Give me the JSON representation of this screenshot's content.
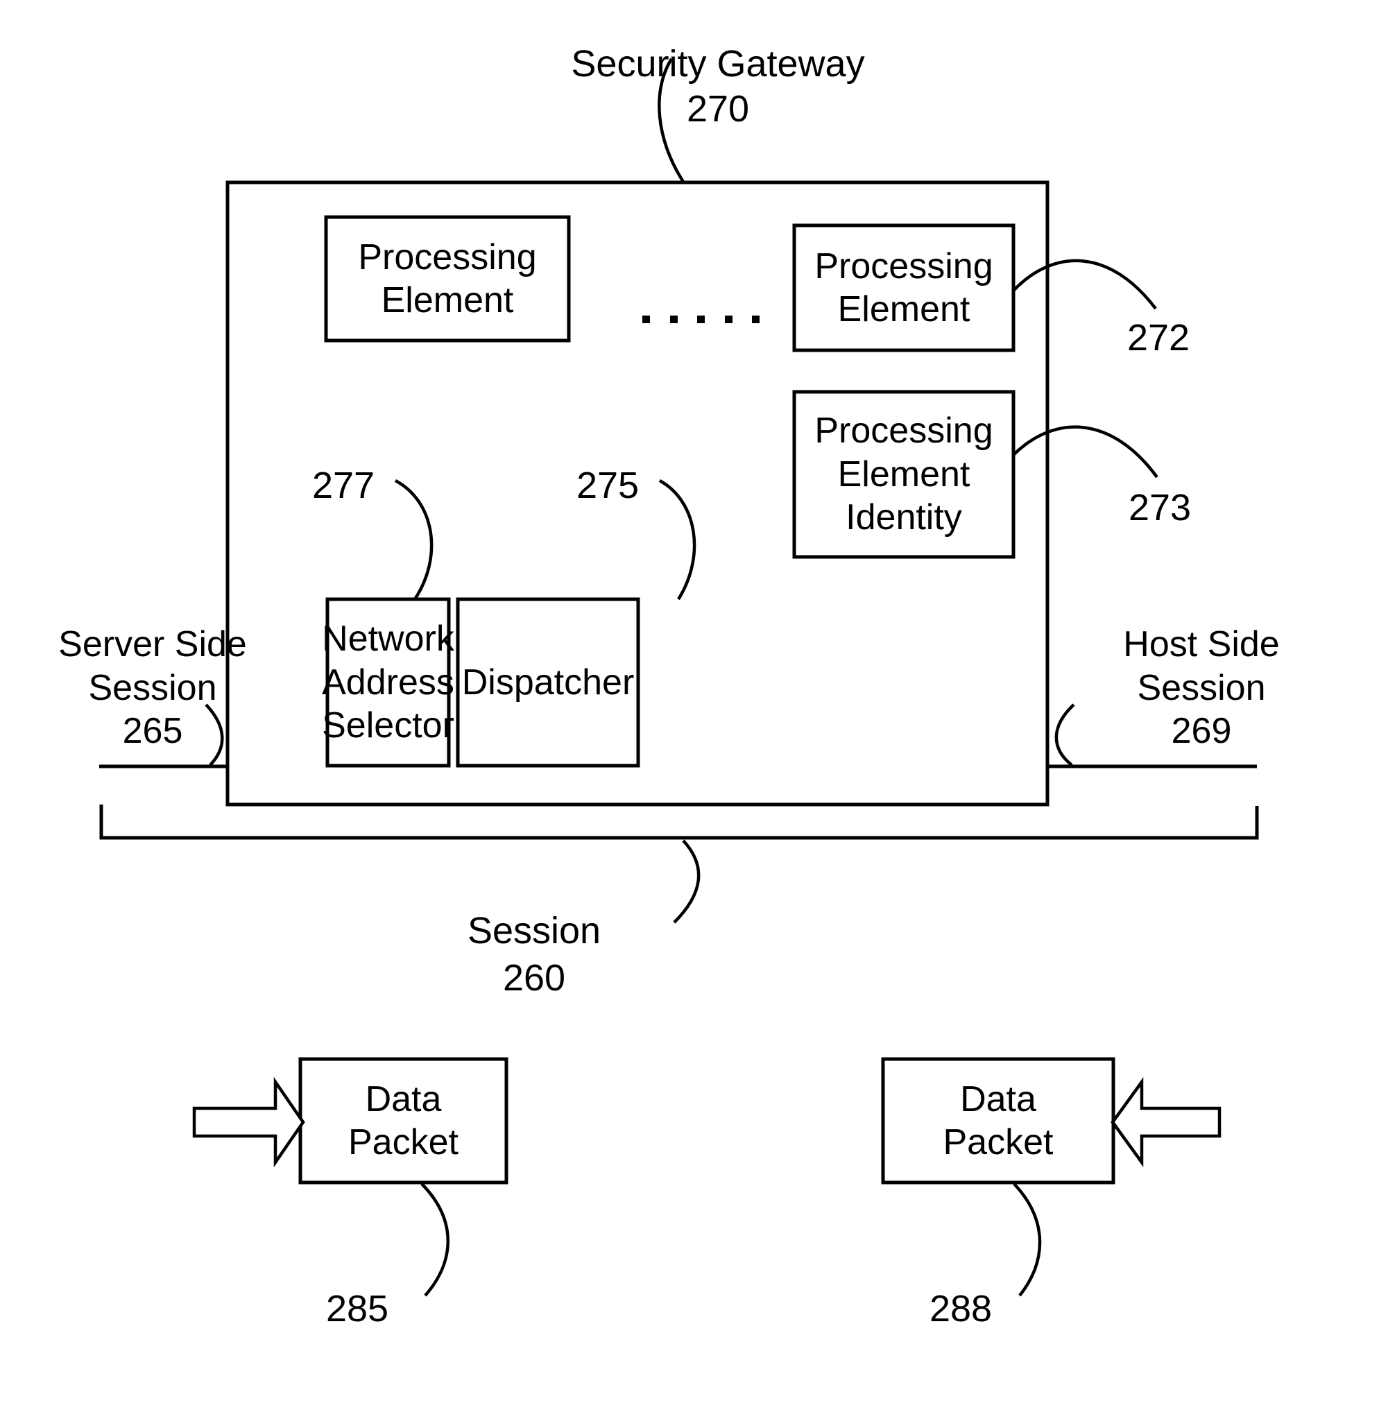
{
  "figure": {
    "title_callout": {
      "label": "Security Gateway",
      "ref": "270"
    },
    "gateway": {
      "processing_element_left": "Processing\nElement",
      "ellipsis": ". . . . .",
      "processing_element_right": "Processing\nElement",
      "processing_element_right_ref": "272",
      "processing_element_identity": "Processing\nElement\nIdentity",
      "processing_element_identity_ref": "273",
      "network_address_selector": "Network\nAddress\nSelector",
      "network_address_selector_ref": "277",
      "dispatcher": "Dispatcher",
      "dispatcher_ref": "275"
    },
    "sessions": {
      "server_side": {
        "label": "Server Side\nSession",
        "ref": "265"
      },
      "host_side": {
        "label": "Host Side\nSession",
        "ref": "269"
      },
      "overall": {
        "label": "Session",
        "ref": "260"
      }
    },
    "packets": {
      "left": {
        "label": "Data\nPacket",
        "ref": "285",
        "arrow_direction": "right"
      },
      "right": {
        "label": "Data\nPacket",
        "ref": "288",
        "arrow_direction": "left"
      }
    },
    "colors": {
      "stroke": "#000000",
      "fill": "#ffffff",
      "background": "#ffffff"
    }
  }
}
